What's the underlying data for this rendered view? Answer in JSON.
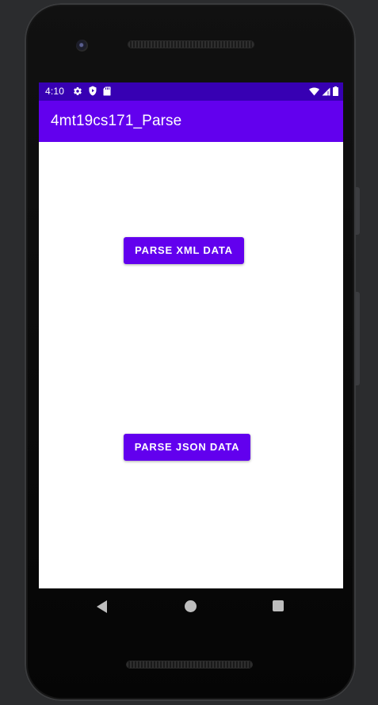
{
  "status_bar": {
    "time": "4:10",
    "left_icons": [
      "settings-icon",
      "play-protect-icon",
      "sd-card-icon"
    ],
    "right_icons": [
      "wifi-icon",
      "cellular-signal-icon",
      "battery-icon"
    ]
  },
  "app_bar": {
    "title": "4mt19cs171_Parse"
  },
  "main": {
    "parse_xml_label": "PARSE XML DATA",
    "parse_json_label": "PARSE JSON DATA"
  },
  "nav_bar": {
    "icons": [
      "back-icon",
      "home-icon",
      "recents-icon"
    ]
  },
  "colors": {
    "primary": "#6200ee",
    "primary_dark": "#3700b3",
    "screen_background": "#ffffff",
    "device_background": "#2b2c2e"
  }
}
